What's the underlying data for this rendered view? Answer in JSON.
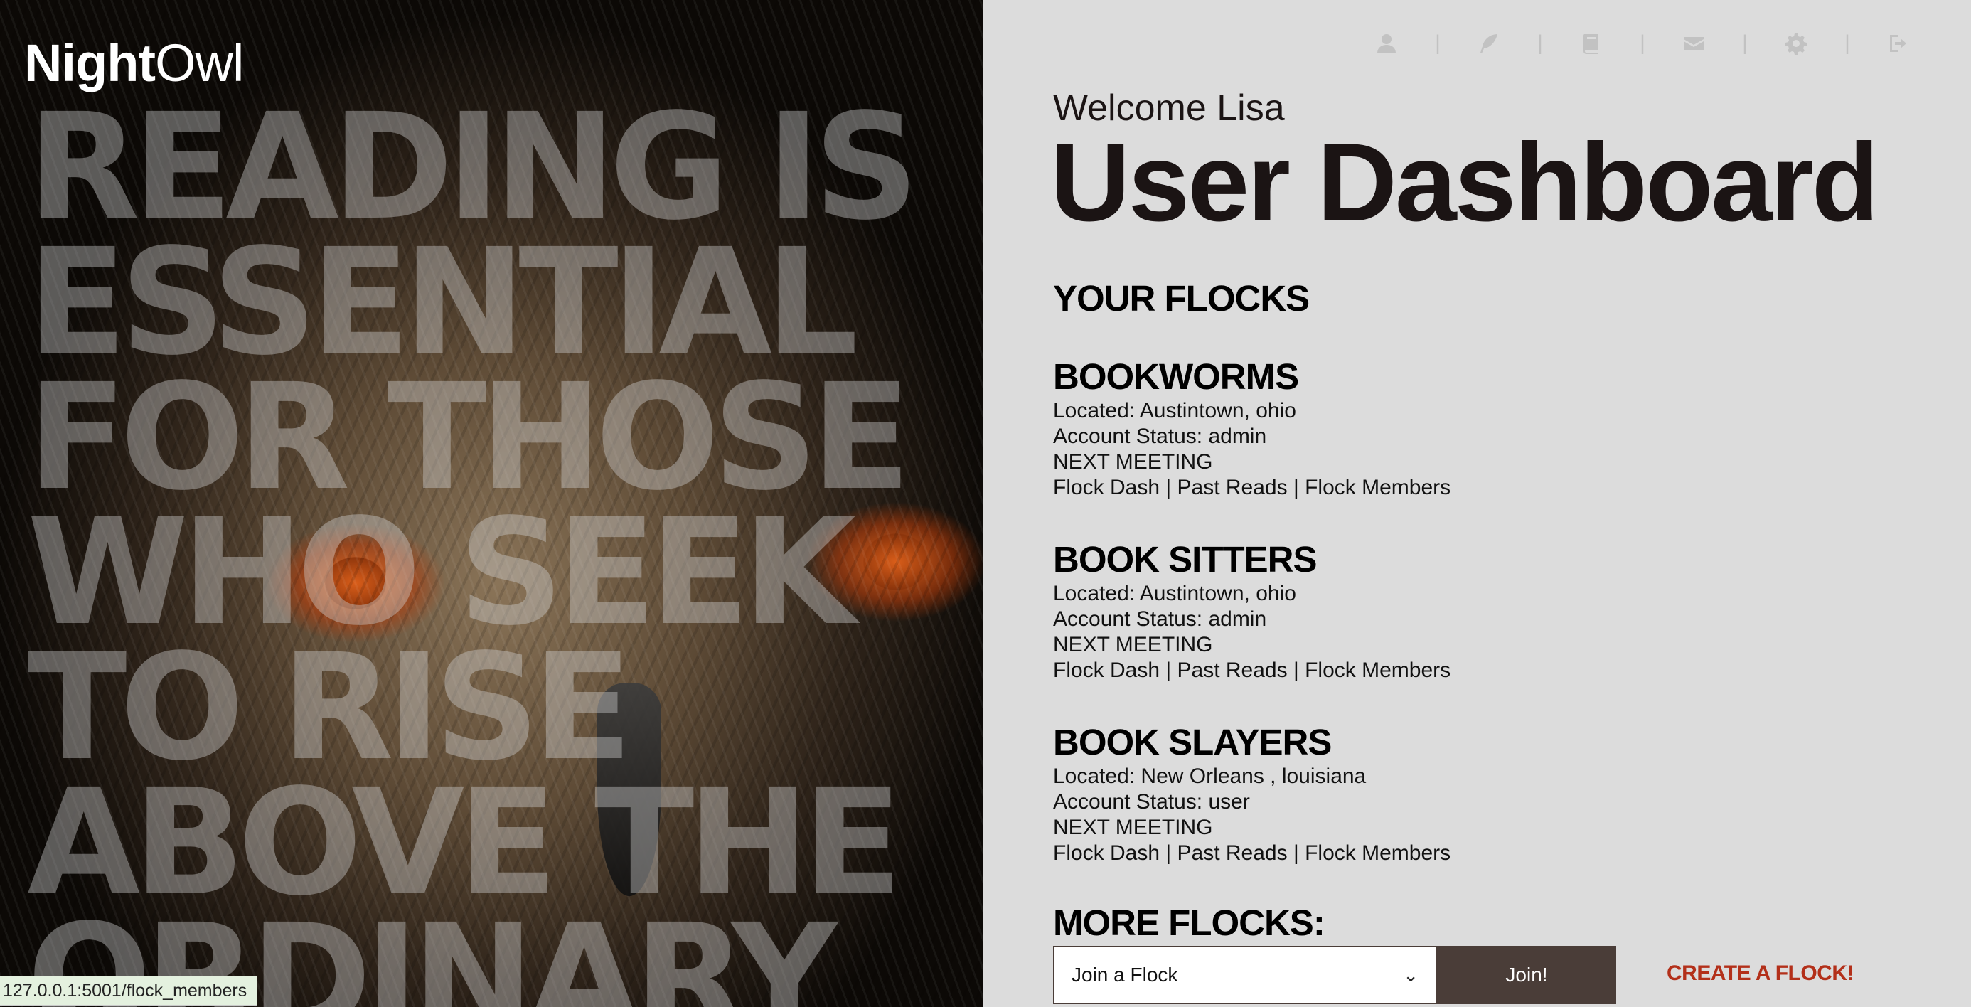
{
  "brand": {
    "part1": "Night",
    "part2": "Owl"
  },
  "hero": {
    "quote_lines": [
      "READING IS",
      "ESSENTIAL",
      "FOR THOSE",
      "WHO SEEK",
      "TO RISE",
      "ABOVE THE",
      "ORDINARY"
    ]
  },
  "nav": {
    "icons": [
      "user-icon",
      "feather-icon",
      "book-icon",
      "envelope-icon",
      "gear-icon",
      "logout-icon"
    ],
    "separator": "|"
  },
  "header": {
    "welcome": "Welcome Lisa",
    "title": "User Dashboard"
  },
  "your_flocks": {
    "heading": "YOUR FLOCKS",
    "items": [
      {
        "name": "BOOKWORMS",
        "located": "Located: Austintown, ohio",
        "status": "Account Status: admin",
        "next_meeting": "NEXT MEETING",
        "links": {
          "dash": "Flock Dash",
          "past": "Past Reads",
          "members": "Flock Members"
        }
      },
      {
        "name": "BOOK SITTERS",
        "located": "Located: Austintown, ohio",
        "status": "Account Status: admin",
        "next_meeting": "NEXT MEETING",
        "links": {
          "dash": "Flock Dash",
          "past": "Past Reads",
          "members": "Flock Members"
        }
      },
      {
        "name": "BOOK SLAYERS",
        "located": "Located: New Orleans , louisiana",
        "status": "Account Status: user",
        "next_meeting": "NEXT MEETING",
        "links": {
          "dash": "Flock Dash",
          "past": "Past Reads",
          "members": "Flock Members"
        }
      }
    ],
    "link_separator": "|"
  },
  "more_flocks": {
    "heading": "MORE FLOCKS:",
    "select_value": "Join a Flock",
    "join_label": "Join!",
    "create_label": "CREATE A FLOCK!"
  },
  "status_bar": {
    "url": "127.0.0.1:5001/flock_members"
  },
  "colors": {
    "accent": "#b3301a",
    "button": "#4a3d38",
    "background": "#dcdcdc",
    "icon": "#c2c2c2"
  }
}
